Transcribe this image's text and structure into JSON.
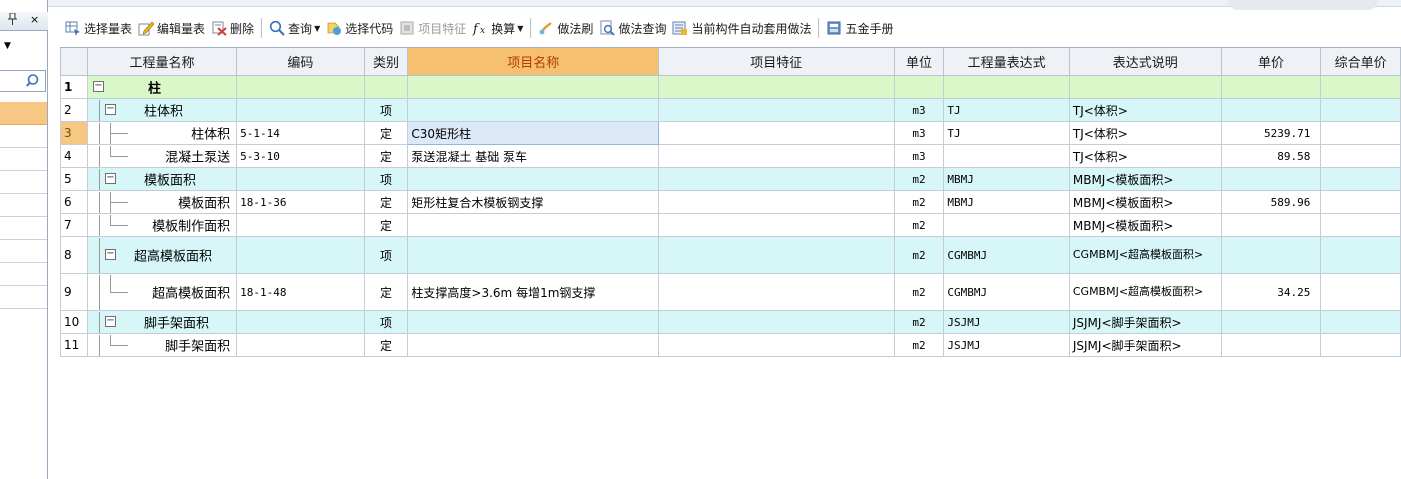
{
  "left_panel": {
    "pin_glyph": "📌",
    "close_glyph": "×",
    "dropdown_glyph": "▼",
    "search_icon": "search-icon"
  },
  "toolbar": [
    {
      "id": "select-table",
      "label": "选择量表",
      "icon": "table-select-icon",
      "disabled": false
    },
    {
      "id": "edit-table",
      "label": "编辑量表",
      "icon": "edit-pencil-icon",
      "disabled": false
    },
    {
      "id": "delete",
      "label": "删除",
      "icon": "delete-icon",
      "disabled": false
    },
    {
      "sep": true
    },
    {
      "id": "query",
      "label": "查询",
      "icon": "magnifier-icon",
      "disabled": false,
      "dropdown": true
    },
    {
      "id": "select-code",
      "label": "选择代码",
      "icon": "code-select-icon",
      "disabled": false
    },
    {
      "id": "item-feature",
      "label": "项目特征",
      "icon": "feature-icon",
      "disabled": true
    },
    {
      "id": "convert",
      "label": "换算",
      "icon": "formula-icon",
      "disabled": false,
      "dropdown": true
    },
    {
      "sep": true
    },
    {
      "id": "method-brush",
      "label": "做法刷",
      "icon": "brush-icon",
      "disabled": false
    },
    {
      "id": "method-query",
      "label": "做法查询",
      "icon": "doc-search-icon",
      "disabled": false
    },
    {
      "id": "auto-apply",
      "label": "当前构件自动套用做法",
      "icon": "auto-apply-icon",
      "disabled": false
    },
    {
      "sep": true
    },
    {
      "id": "hardware-manual",
      "label": "五金手册",
      "icon": "manual-icon",
      "disabled": false
    }
  ],
  "grid": {
    "headers": [
      "",
      "工程量名称",
      "编码",
      "类别",
      "项目名称",
      "项目特征",
      "单位",
      "工程量表达式",
      "表达式说明",
      "单价",
      "综合单价"
    ],
    "rows": [
      {
        "num": "1",
        "level": 0,
        "type": "g1",
        "expand": true,
        "name": "柱",
        "code": "",
        "cat": "",
        "pname": "",
        "feat": "",
        "unit": "",
        "expr": "",
        "desc": "",
        "price": ""
      },
      {
        "num": "2",
        "level": 1,
        "type": "g2",
        "expand": true,
        "name": "柱体积",
        "code": "",
        "cat": "项",
        "pname": "",
        "feat": "",
        "unit": "m3",
        "expr": "TJ",
        "desc": "TJ<体积>",
        "price": ""
      },
      {
        "num": "3",
        "level": 2,
        "type": "g3",
        "name": "柱体积",
        "code": "5-1-14",
        "cat": "定",
        "pname": "C30矩形柱",
        "feat": "",
        "unit": "m3",
        "expr": "TJ",
        "desc": "TJ<体积>",
        "price": "5239.71",
        "current": true
      },
      {
        "num": "4",
        "level": 2,
        "type": "g3",
        "last": true,
        "name": "混凝土泵送",
        "code": "5-3-10",
        "cat": "定",
        "pname": "泵送混凝土 基础 泵车",
        "feat": "",
        "unit": "m3",
        "expr": "",
        "desc": "TJ<体积>",
        "price": "89.58"
      },
      {
        "num": "5",
        "level": 1,
        "type": "g2",
        "expand": true,
        "name": "模板面积",
        "code": "",
        "cat": "项",
        "pname": "",
        "feat": "",
        "unit": "m2",
        "expr": "MBMJ",
        "desc": "MBMJ<模板面积>",
        "price": ""
      },
      {
        "num": "6",
        "level": 2,
        "type": "g3",
        "name": "模板面积",
        "code": "18-1-36",
        "cat": "定",
        "pname": "矩形柱复合木模板钢支撑",
        "feat": "",
        "unit": "m2",
        "expr": "MBMJ",
        "desc": "MBMJ<模板面积>",
        "price": "589.96"
      },
      {
        "num": "7",
        "level": 2,
        "type": "g3",
        "last": true,
        "name": "模板制作面积",
        "code": "",
        "cat": "定",
        "pname": "",
        "feat": "",
        "unit": "m2",
        "expr": "",
        "desc": "MBMJ<模板面积>",
        "price": ""
      },
      {
        "num": "8",
        "level": 1,
        "type": "g2",
        "expand": true,
        "tall": true,
        "name": "超高模板面积",
        "code": "",
        "cat": "项",
        "pname": "",
        "feat": "",
        "unit": "m2",
        "expr": "CGMBMJ",
        "desc": "CGMBMJ<超高模板面积>",
        "price": ""
      },
      {
        "num": "9",
        "level": 2,
        "type": "g3",
        "tall": true,
        "last": true,
        "name": "超高模板面积",
        "code": "18-1-48",
        "cat": "定",
        "pname": "柱支撑高度>3.6m 每增1m钢支撑",
        "feat": "",
        "unit": "m2",
        "expr": "CGMBMJ",
        "desc": "CGMBMJ<超高模板面积>",
        "price": "34.25"
      },
      {
        "num": "10",
        "level": 1,
        "type": "g2",
        "expand": true,
        "name": "脚手架面积",
        "code": "",
        "cat": "项",
        "pname": "",
        "feat": "",
        "unit": "m2",
        "expr": "JSJMJ",
        "desc": "JSJMJ<脚手架面积>",
        "price": ""
      },
      {
        "num": "11",
        "level": 2,
        "type": "g3",
        "last": true,
        "name": "脚手架面积",
        "code": "",
        "cat": "定",
        "pname": "",
        "feat": "",
        "unit": "m2",
        "expr": "JSJMJ",
        "desc": "JSJMJ<脚手架面积>",
        "price": ""
      }
    ]
  },
  "colors": {
    "group1": "#d9f7c8",
    "group2": "#d6f6f8",
    "highlight_header": "#f5c171",
    "selection": "#f6c884"
  }
}
